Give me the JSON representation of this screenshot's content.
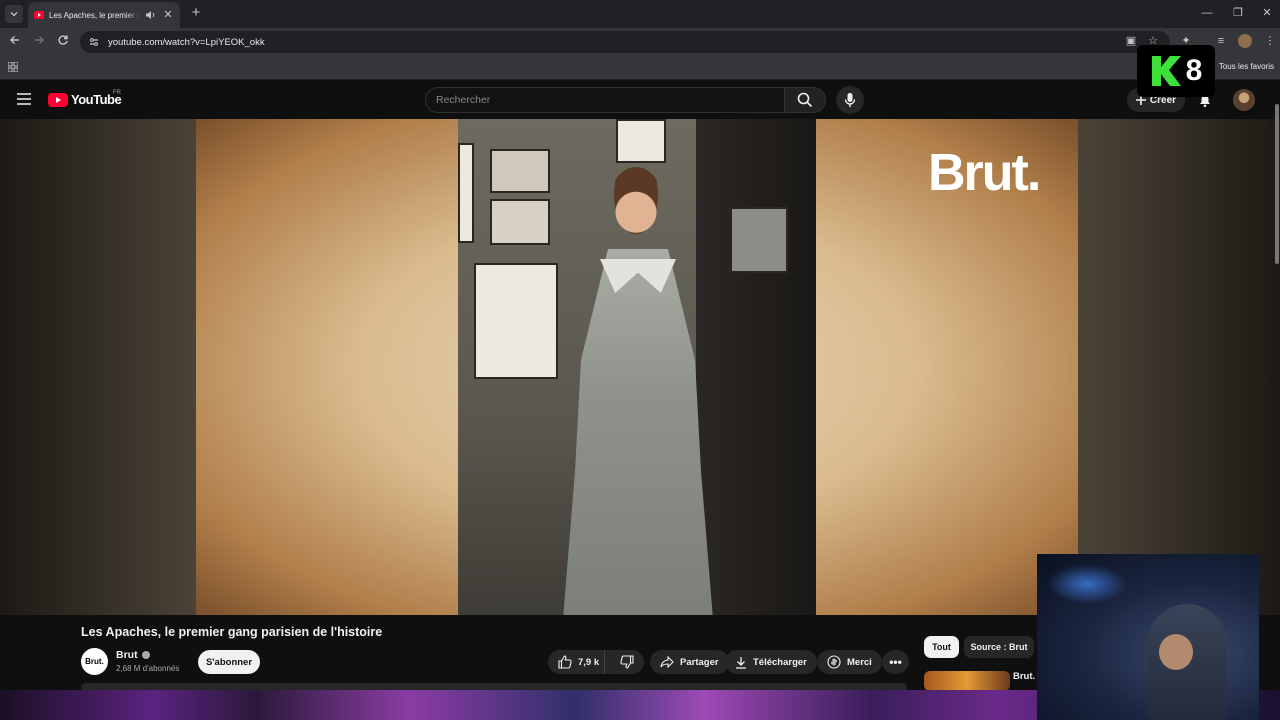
{
  "browser": {
    "tab_title": "Les Apaches, le premier gang parisien de l'histoire",
    "url": "youtube.com/watch?v=LpiYEOK_okk",
    "bookmarks_all": "Tous les favoris"
  },
  "youtube": {
    "logo_text": "YouTube",
    "country_code": "FR",
    "search_placeholder": "Rechercher",
    "create_label": "Créer"
  },
  "video": {
    "overlay_brand": "Brut.",
    "title": "Les Apaches, le premier gang parisien de l'histoire",
    "channel_name": "Brut",
    "channel_avatar_text": "Brut.",
    "subscribers": "2,68 M d'abonnés",
    "subscribe_label": "S'abonner",
    "likes": "7,9 k",
    "share_label": "Partager",
    "download_label": "Télécharger",
    "thanks_label": "Merci"
  },
  "recommendations": {
    "chips": [
      "Tout",
      "Source : Brut"
    ],
    "first_title": "Brut."
  },
  "overlay": {
    "badge_number": "8"
  },
  "colors": {
    "youtube_red": "#ff0033",
    "background": "#0f0f0f",
    "k8_green": "#3ee03a"
  }
}
